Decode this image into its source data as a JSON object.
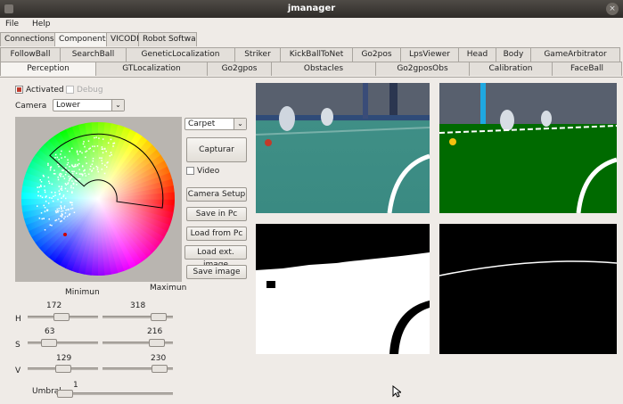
{
  "window": {
    "title": "jmanager"
  },
  "menu": [
    "File",
    "Help"
  ],
  "top_tabs": [
    {
      "label": "Connections",
      "active": false
    },
    {
      "label": "Components",
      "active": true
    },
    {
      "label": "VICODE",
      "active": false
    },
    {
      "label": "Robot Software",
      "active": false
    }
  ],
  "component_tabs": [
    "FollowBall",
    "SearchBall",
    "GeneticLocalization",
    "Striker",
    "KickBallToNet",
    "Go2pos",
    "LpsViewer",
    "Head",
    "Body",
    "GameArbitrator"
  ],
  "component_tabs2": [
    {
      "label": "Perception",
      "active": true
    },
    {
      "label": "GTLocalization",
      "active": false
    },
    {
      "label": "Go2gpos",
      "active": false
    },
    {
      "label": "Obstacles",
      "active": false
    },
    {
      "label": "Go2gposObs",
      "active": false
    },
    {
      "label": "Calibration",
      "active": false
    },
    {
      "label": "FaceBall",
      "active": false
    }
  ],
  "perception": {
    "activated_label": "Activated",
    "debug_label": "Debug",
    "camera_label": "Camera",
    "camera_value": "Lower",
    "filter_value": "Carpet",
    "capture_button": "Capturar",
    "video_label": "Video",
    "camera_setup_button": "Camera Setup",
    "save_pc_button": "Save in Pc",
    "load_pc_button": "Load from Pc",
    "load_ext_button": "Load ext. image",
    "save_image_button": "Save image",
    "minimum_label": "Minimun",
    "maximum_label": "Maximun",
    "h_label": "H",
    "s_label": "S",
    "v_label": "V",
    "threshold_label": "Umbral",
    "sliders": {
      "h_min": 172,
      "h_max": 318,
      "s_min": 63,
      "s_max": 216,
      "v_min": 129,
      "v_max": 230,
      "umbral": 1
    },
    "slider_range_max": 360,
    "sv_range_max": 255,
    "umbral_range_max": 100
  },
  "colors": {
    "field_green": "#006a00",
    "carpet_photo": "#3f8f86",
    "titlebar": "#3c3935"
  }
}
